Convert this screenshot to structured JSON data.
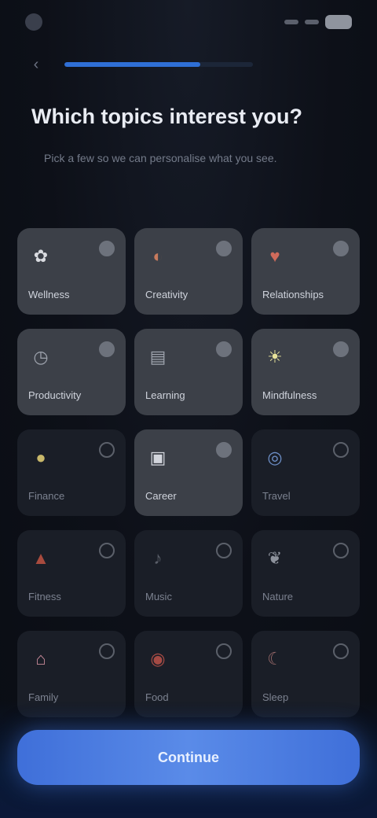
{
  "status_bar": {
    "time": "",
    "battery_icon": "battery-icon"
  },
  "nav": {
    "back_icon": "chevron-left-icon",
    "progress_value": 0.72
  },
  "header": {
    "title": "Which topics interest you?",
    "subtitle": "Pick a few so we can personalise what you see."
  },
  "topics": [
    {
      "label": "Wellness",
      "icon": "flower-icon",
      "icon_color": "#d9dbe0",
      "selected": true
    },
    {
      "label": "Creativity",
      "icon": "palette-icon",
      "icon_color": "#c77a5d",
      "selected": true
    },
    {
      "label": "Relationships",
      "icon": "heart-icon",
      "icon_color": "#cf6b5b",
      "selected": true
    },
    {
      "label": "Productivity",
      "icon": "clock-icon",
      "icon_color": "#9ea3ad",
      "selected": true
    },
    {
      "label": "Learning",
      "icon": "book-icon",
      "icon_color": "#9ea3ad",
      "selected": true
    },
    {
      "label": "Mindfulness",
      "icon": "sun-icon",
      "icon_color": "#e8e39a",
      "selected": true
    },
    {
      "label": "Finance",
      "icon": "coin-icon",
      "icon_color": "#c9b86a",
      "selected": false
    },
    {
      "label": "Career",
      "icon": "briefcase-icon",
      "icon_color": "#d2d5dc",
      "selected": true
    },
    {
      "label": "Travel",
      "icon": "globe-icon",
      "icon_color": "#6d8fc7",
      "selected": false
    },
    {
      "label": "Fitness",
      "icon": "flame-icon",
      "icon_color": "#a84b3e",
      "selected": false
    },
    {
      "label": "Music",
      "icon": "music-icon",
      "icon_color": "#5a5f69",
      "selected": false
    },
    {
      "label": "Nature",
      "icon": "leaf-icon",
      "icon_color": "#8d929c",
      "selected": false
    },
    {
      "label": "Family",
      "icon": "home-icon",
      "icon_color": "#c98a9a",
      "selected": false
    },
    {
      "label": "Food",
      "icon": "apple-icon",
      "icon_color": "#a44a44",
      "selected": false
    },
    {
      "label": "Sleep",
      "icon": "moon-icon",
      "icon_color": "#9a6a6a",
      "selected": false
    }
  ],
  "footer": {
    "continue_label": "Continue"
  }
}
